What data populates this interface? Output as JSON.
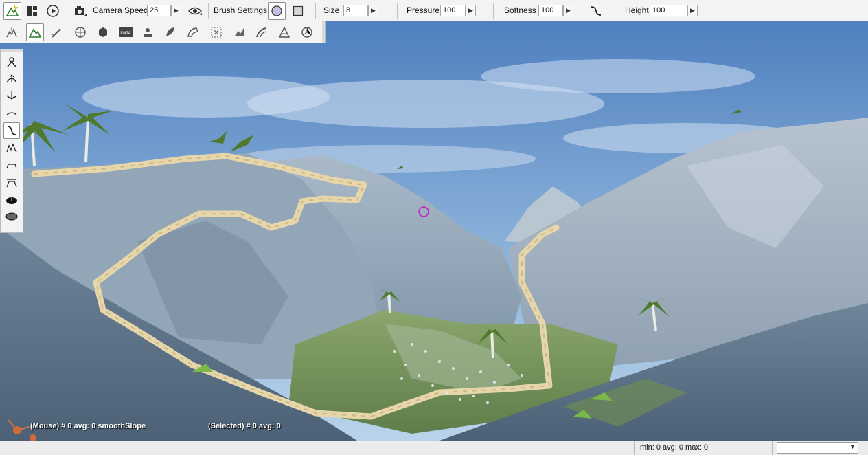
{
  "toolbar": {
    "camera_speed_label": "Camera Speed",
    "camera_speed_value": "25",
    "brush_settings_label": "Brush Settings",
    "size_label": "Size",
    "size_value": "8",
    "pressure_label": "Pressure",
    "pressure_value": "100",
    "softness_label": "Softness",
    "softness_value": "100",
    "height_label": "Height",
    "height_value": "100",
    "active_brush_shape": "circle",
    "softness_curve_icon": "smooth-slope-curve-icon"
  },
  "tool_tabs": [
    "object-editor-icon",
    "terrain-editor-icon",
    "terrain-painter-icon",
    "material-editor-icon",
    "sketch-editor-icon",
    "datablock-editor-icon",
    "decal-editor-icon",
    "forest-editor-icon",
    "mesh-road-editor-icon",
    "convex-editor-icon",
    "river-editor-icon",
    "road-editor-icon",
    "navmesh-editor-icon"
  ],
  "palette": [
    "grab-terrain-icon",
    "raise-height-icon",
    "lower-height-icon",
    "smooth-icon",
    "smooth-slope-icon",
    "paint-noise-icon",
    "flatten-icon",
    "set-height-icon",
    "clear-terrain-icon",
    "restore-terrain-icon"
  ],
  "overlay": {
    "mouse_info": "(Mouse) # 0  avg: 0 smoothSlope",
    "selected_info": "(Selected) # 0  avg: 0"
  },
  "status": {
    "stats": "min: 0  avg: 0  max: 0",
    "dropdown_value": ""
  },
  "colors": {
    "toolbar_bg": "#f3f3f3",
    "brush_circle_fill": "#c7bfe3",
    "brush_cursor": "#c020c0",
    "sky": "#5f8fc5",
    "rock": "#8ea3b8",
    "road": "#e3d3a6"
  }
}
